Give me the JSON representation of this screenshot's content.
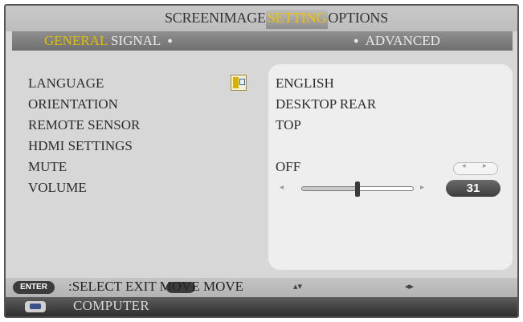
{
  "menu": {
    "tabs": [
      {
        "label": "SCREEN"
      },
      {
        "label": "IMAGE"
      },
      {
        "label": "SETTING"
      },
      {
        "label": "OPTIONS"
      }
    ],
    "active_tab": "SETTING",
    "subtabs": {
      "left_active": "GENERAL",
      "left_next": "SIGNAL",
      "right": "ADVANCED"
    }
  },
  "settings": [
    {
      "label": "LANGUAGE",
      "value": "ENGLISH"
    },
    {
      "label": "ORIENTATION",
      "value": "DESKTOP REAR"
    },
    {
      "label": "REMOTE SENSOR",
      "value": "TOP"
    },
    {
      "label": "HDMI SETTINGS",
      "value": ""
    },
    {
      "label": "MUTE",
      "value": "OFF"
    },
    {
      "label": "VOLUME",
      "value": "31"
    }
  ],
  "volume_level": 0.5,
  "footer": {
    "enter_label": "ENTER",
    "help_text": ":SELECT EXIT MOVE MOVE",
    "arrows_updown": "▴▾",
    "arrows_leftright": "◂▸"
  },
  "source": {
    "icon": "monitor-icon",
    "label": "COMPUTER"
  },
  "colors": {
    "accent": "#f0c300",
    "panel": "#eeeeee",
    "background": "#d7d7d7"
  }
}
